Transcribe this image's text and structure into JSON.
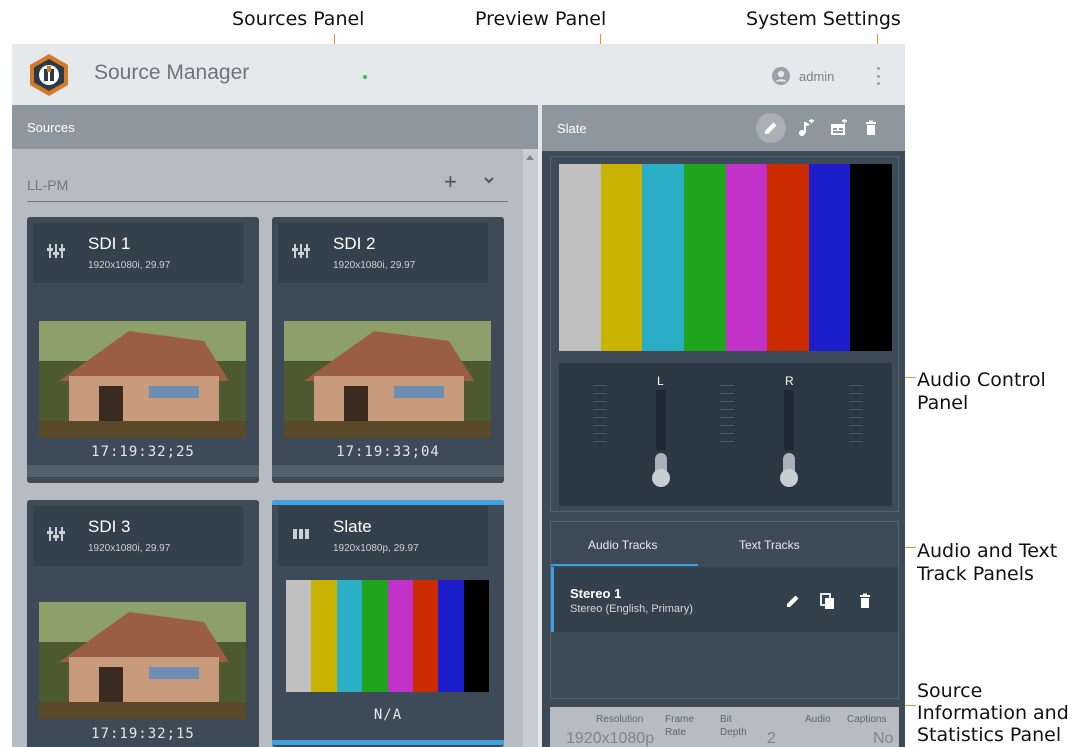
{
  "callouts": {
    "sources_panel": "Sources Panel",
    "preview_panel": "Preview Panel",
    "system_settings": "System Settings",
    "audio_control_line1": "Audio Control",
    "audio_control_line2": "Panel",
    "tracks_line1": "Audio and Text",
    "tracks_line2": "Track Panels",
    "info_line1": "Source",
    "info_line2": "Information and",
    "info_line3": "Statistics Panel"
  },
  "header": {
    "app_title": "Source Manager",
    "user_name": "admin",
    "user_icon": "account-circle-icon",
    "menu_icon": "kebab-menu-icon"
  },
  "sources": {
    "title": "Sources",
    "group_name": "LL-PM",
    "add_label": "+",
    "cards": [
      {
        "name": "SDI 1",
        "resolution": "1920x1080i, 29.97",
        "timecode": "17:19:32;25",
        "icon": "sdi-input-icon"
      },
      {
        "name": "SDI 2",
        "resolution": "1920x1080i, 29.97",
        "timecode": "17:19:33;04",
        "icon": "sdi-input-icon"
      },
      {
        "name": "SDI 3",
        "resolution": "1920x1080i, 29.97",
        "timecode": "17:19:32;15",
        "icon": "sdi-input-icon"
      },
      {
        "name": "Slate",
        "resolution": "1920x1080p, 29.97",
        "timecode": "N/A",
        "icon": "color-bars-icon",
        "selected": true
      }
    ]
  },
  "preview": {
    "title": "Slate",
    "buttons": [
      "edit-icon",
      "add-audio-icon",
      "add-caption-icon",
      "delete-icon"
    ],
    "color_bars": [
      "#c0c0c0",
      "#c8b400",
      "#2aaec6",
      "#1ea51b",
      "#c332c8",
      "#cc2a00",
      "#1c1ecc",
      "#000000"
    ]
  },
  "audio": {
    "left_label": "L",
    "right_label": "R"
  },
  "tracks": {
    "tab_audio": "Audio Tracks",
    "tab_text": "Text Tracks",
    "track_name": "Stereo 1",
    "track_desc": "Stereo (English, Primary)"
  },
  "info": {
    "resolution_label": "Resolution",
    "resolution_value": "1920x1080p",
    "framerate_label_1": "Frame",
    "framerate_label_2": "Rate",
    "bitdepth_label_1": "Bit",
    "bitdepth_label_2": "Depth",
    "bitdepth_value": "2",
    "audio_label": "Audio",
    "captions_label": "Captions",
    "captions_value": "No"
  }
}
